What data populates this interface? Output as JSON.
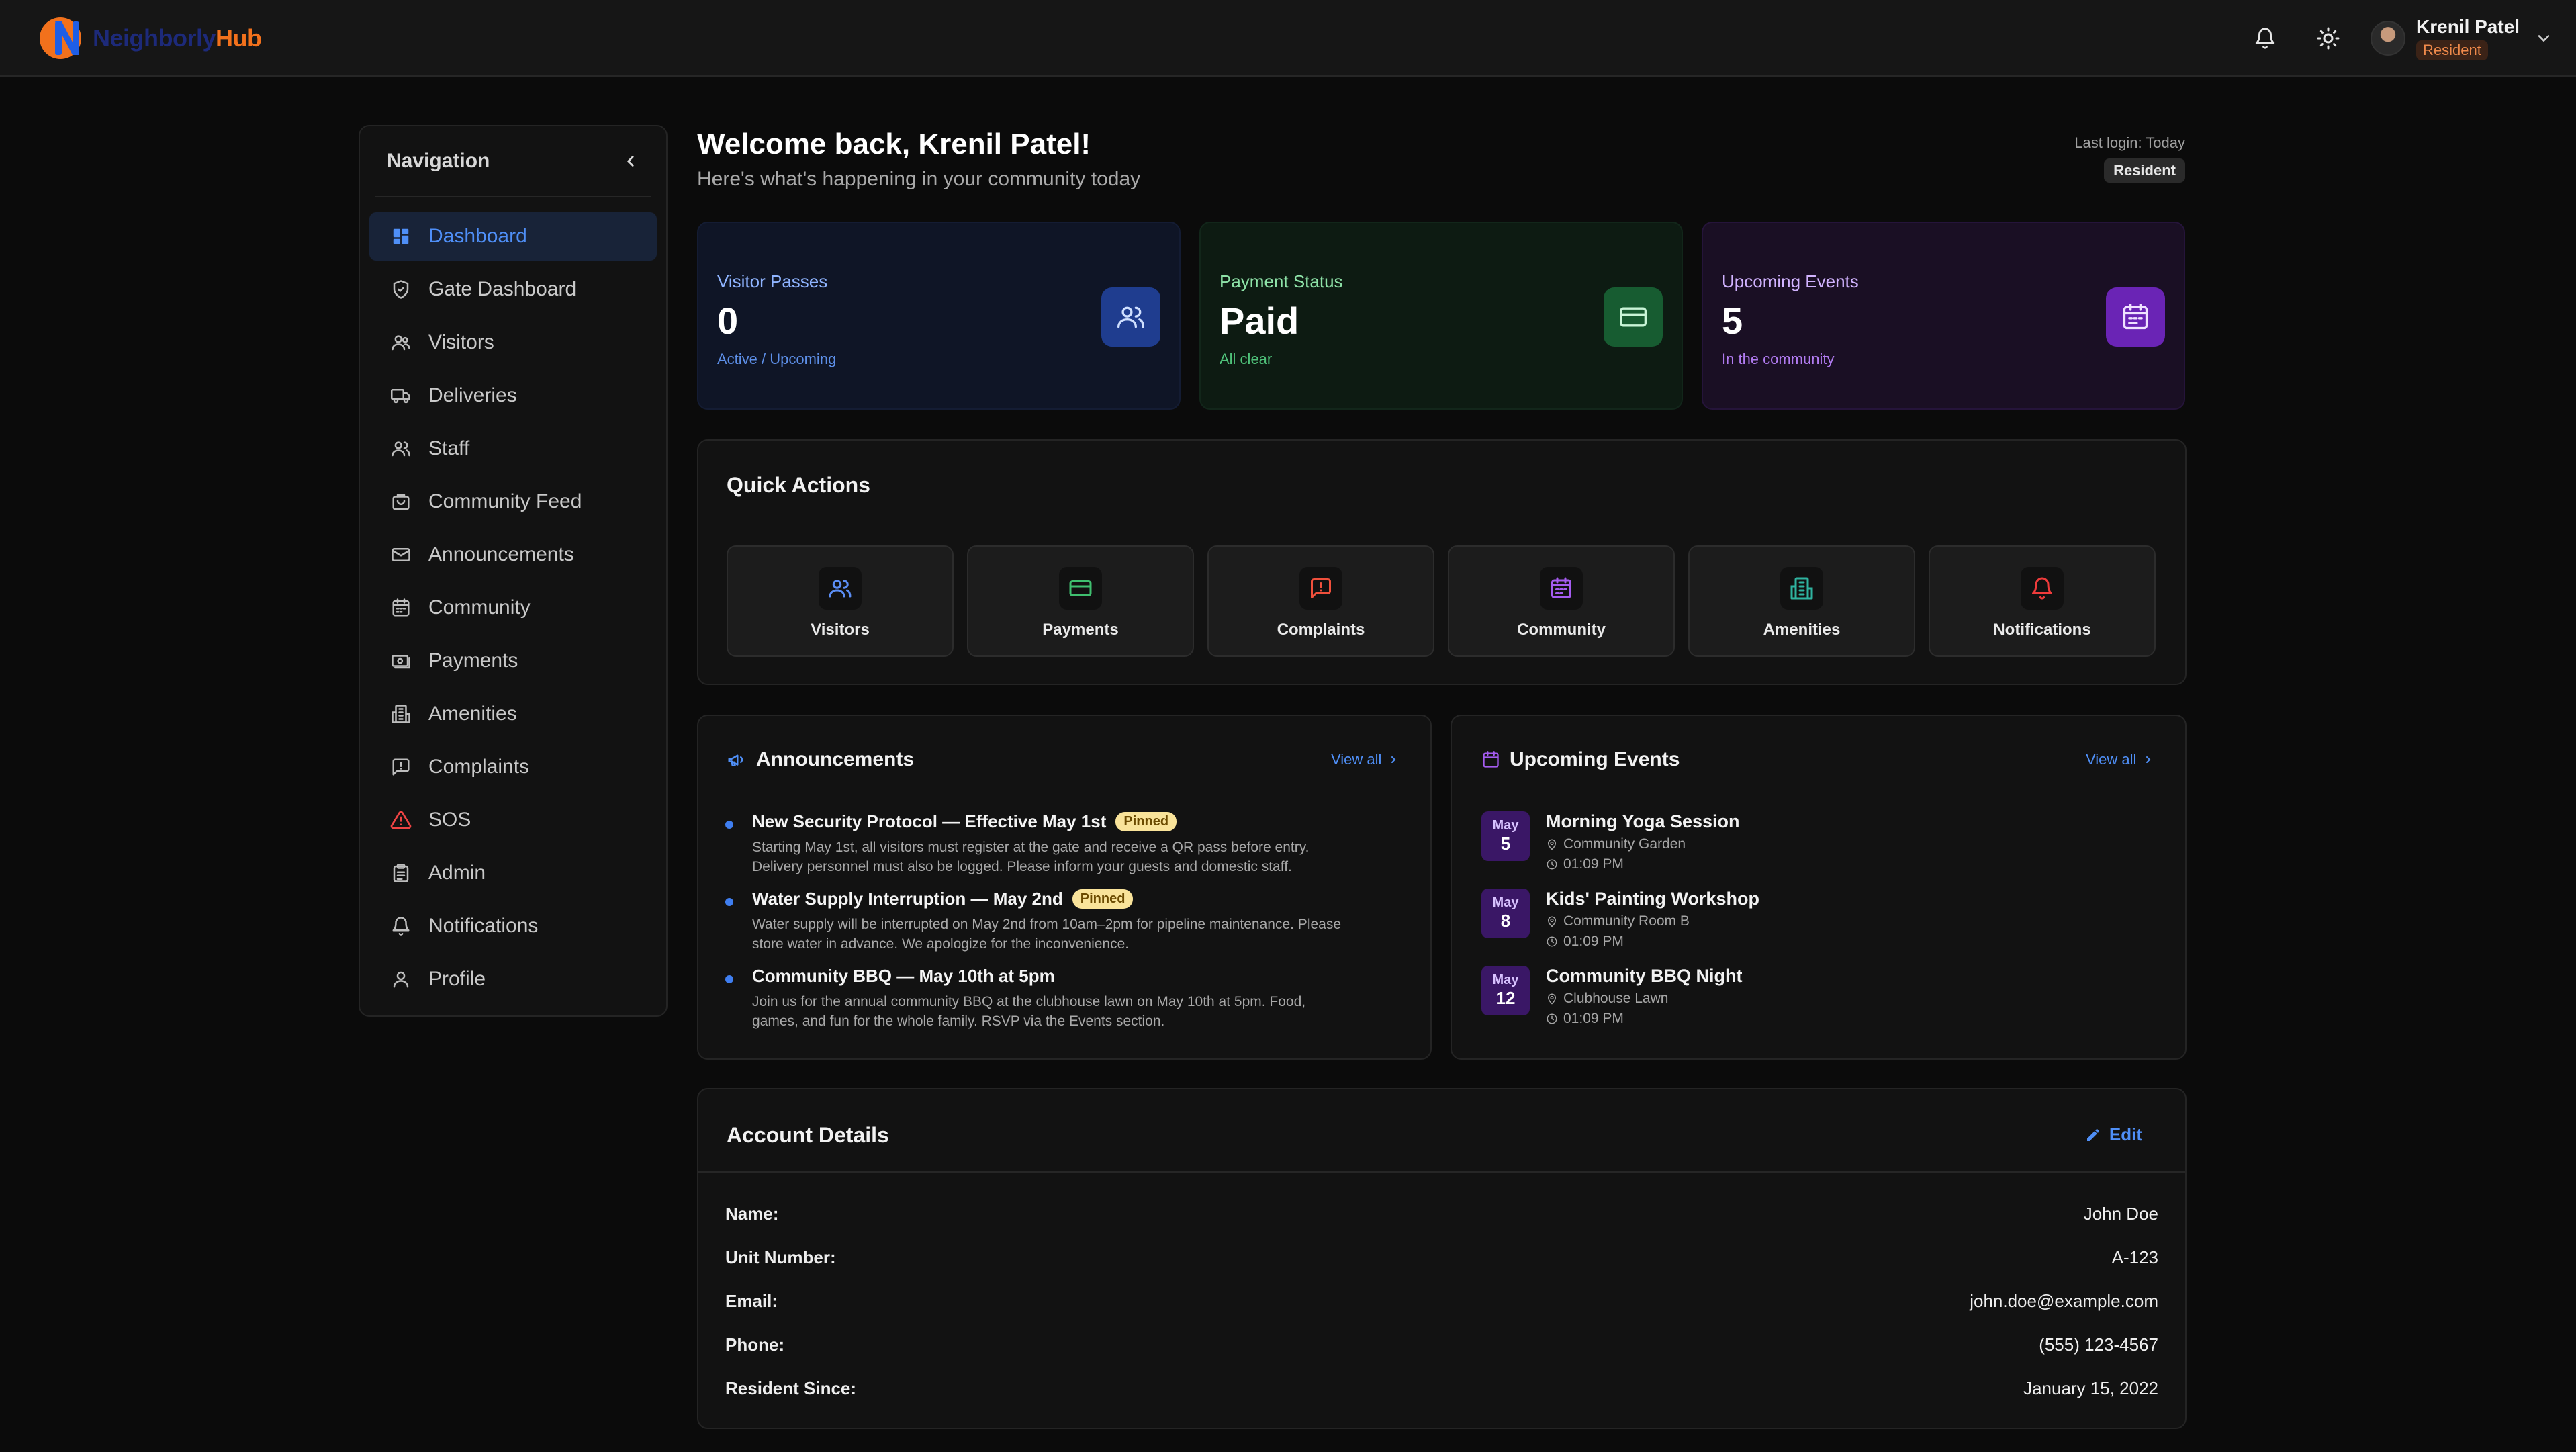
{
  "app": {
    "brand_part1": "Neighborly",
    "brand_part2": "Hub",
    "accent": "#4f8ff7",
    "brand_orange": "#f2711c"
  },
  "topbar": {
    "icons": [
      "bell-icon",
      "sun-icon"
    ],
    "user_name": "Krenil Patel",
    "user_role": "Resident"
  },
  "sidebar": {
    "title": "Navigation",
    "items": [
      {
        "label": "Dashboard",
        "icon": "dashboard-icon",
        "active": true
      },
      {
        "label": "Gate Dashboard",
        "icon": "shield-icon"
      },
      {
        "label": "Visitors",
        "icon": "users-icon"
      },
      {
        "label": "Deliveries",
        "icon": "truck-icon"
      },
      {
        "label": "Staff",
        "icon": "user-group-icon"
      },
      {
        "label": "Community Feed",
        "icon": "bag-icon"
      },
      {
        "label": "Announcements",
        "icon": "mail-icon"
      },
      {
        "label": "Community",
        "icon": "calendar-icon"
      },
      {
        "label": "Payments",
        "icon": "banknote-icon"
      },
      {
        "label": "Amenities",
        "icon": "building-icon"
      },
      {
        "label": "Complaints",
        "icon": "message-alert-icon"
      },
      {
        "label": "SOS",
        "icon": "warning-icon"
      },
      {
        "label": "Admin",
        "icon": "clipboard-icon"
      },
      {
        "label": "Notifications",
        "icon": "bell-icon"
      },
      {
        "label": "Profile",
        "icon": "user-icon"
      }
    ]
  },
  "welcome": {
    "title": "Welcome back, Krenil Patel!",
    "subtitle": "Here's what's happening in your community today",
    "last_login": "Last login: Today",
    "role_badge": "Resident"
  },
  "stats": [
    {
      "label": "Visitor Passes",
      "value": "0",
      "sub": "Active / Upcoming",
      "icon": "users-icon"
    },
    {
      "label": "Payment Status",
      "value": "Paid",
      "sub": "All clear",
      "icon": "credit-card-icon"
    },
    {
      "label": "Upcoming Events",
      "value": "5",
      "sub": "In the community",
      "icon": "calendar-icon"
    }
  ],
  "quick_actions": {
    "title": "Quick Actions",
    "items": [
      {
        "label": "Visitors",
        "icon": "users-icon"
      },
      {
        "label": "Payments",
        "icon": "credit-card-icon"
      },
      {
        "label": "Complaints",
        "icon": "message-alert-icon"
      },
      {
        "label": "Community",
        "icon": "calendar-icon"
      },
      {
        "label": "Amenities",
        "icon": "building-icon"
      },
      {
        "label": "Notifications",
        "icon": "bell-icon"
      }
    ]
  },
  "announcements": {
    "title": "Announcements",
    "view_all": "View all",
    "items": [
      {
        "title": "New Security Protocol — Effective May 1st",
        "badge": "Pinned",
        "body_line1": "Starting May 1st, all visitors must register at the gate and receive a QR pass before entry.",
        "body_line2": "Delivery personnel must also be logged. Please inform your guests and domestic staff."
      },
      {
        "title": "Water Supply Interruption — May 2nd",
        "badge": "Pinned",
        "body_line1": "Water supply will be interrupted on May 2nd from 10am–2pm for pipeline maintenance. Please",
        "body_line2": "store water in advance. We apologize for the inconvenience."
      },
      {
        "title": "Community BBQ — May 10th at 5pm",
        "badge": "",
        "body_line1": "Join us for the annual community BBQ at the clubhouse lawn on May 10th at 5pm. Food,",
        "body_line2": "games, and fun for the whole family. RSVP via the Events section."
      }
    ]
  },
  "events": {
    "title": "Upcoming Events",
    "view_all": "View all",
    "items": [
      {
        "month": "May",
        "day": "5",
        "name": "Morning Yoga Session",
        "location": "Community Garden",
        "time": "01:09 PM"
      },
      {
        "month": "May",
        "day": "8",
        "name": "Kids' Painting Workshop",
        "location": "Community Room B",
        "time": "01:09 PM"
      },
      {
        "month": "May",
        "day": "12",
        "name": "Community BBQ Night",
        "location": "Clubhouse Lawn",
        "time": "01:09 PM"
      }
    ]
  },
  "account": {
    "title": "Account Details",
    "edit_label": "Edit",
    "rows": [
      {
        "key": "Name:",
        "value": "John Doe"
      },
      {
        "key": "Unit Number:",
        "value": "A-123"
      },
      {
        "key": "Email:",
        "value": "john.doe@example.com"
      },
      {
        "key": "Phone:",
        "value": "(555) 123-4567"
      },
      {
        "key": "Resident Since:",
        "value": "January 15, 2022"
      }
    ]
  }
}
